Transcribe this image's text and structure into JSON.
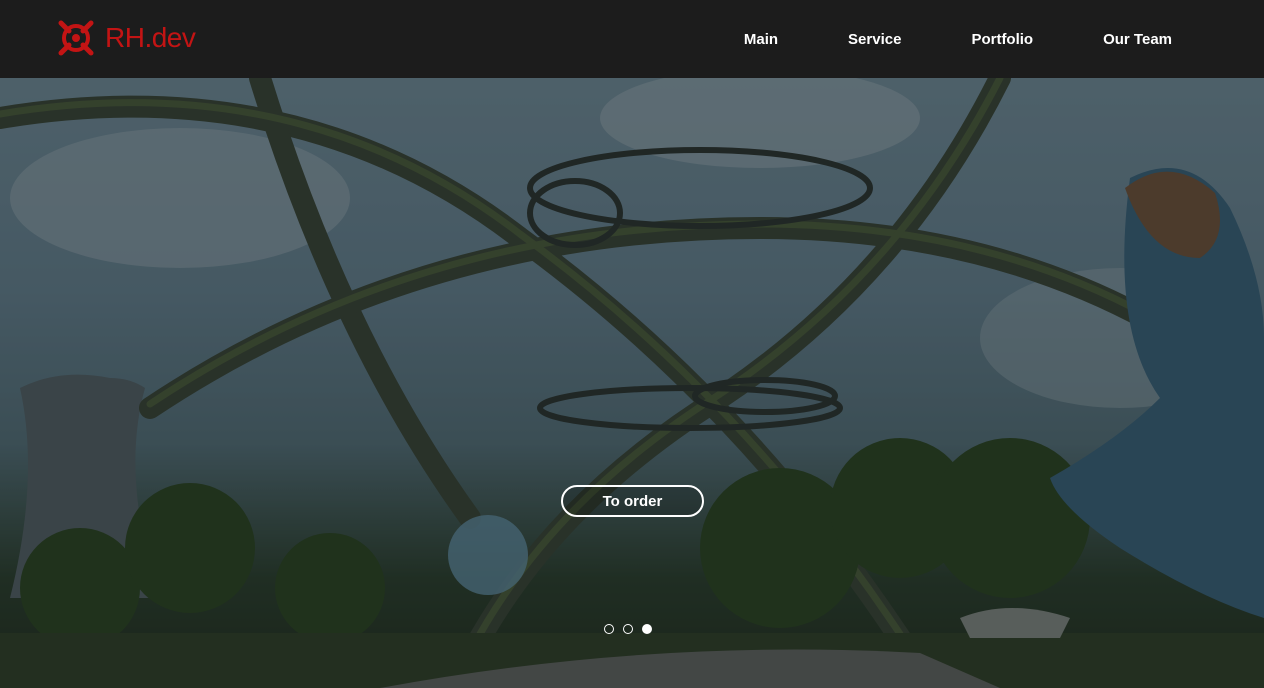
{
  "brand": {
    "name": "RH.dev",
    "logo_icon": "crosshair-logo-icon",
    "color": "#c31414"
  },
  "nav": {
    "items": [
      {
        "label": "Main"
      },
      {
        "label": "Service"
      },
      {
        "label": "Portfolio"
      },
      {
        "label": "Our Team"
      }
    ]
  },
  "hero": {
    "cta_label": "To order",
    "slides_count": 3,
    "active_slide_index": 2
  }
}
